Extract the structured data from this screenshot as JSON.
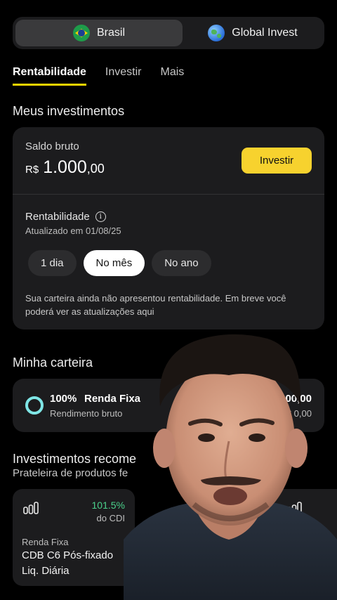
{
  "region": {
    "options": [
      {
        "label": "Brasil",
        "icon": "brazil-flag-icon",
        "active": true
      },
      {
        "label": "Global Invest",
        "icon": "globe-icon",
        "active": false
      }
    ]
  },
  "tabs": [
    "Rentabilidade",
    "Investir",
    "Mais"
  ],
  "section_investments": "Meus investimentos",
  "investments": {
    "saldo_label": "Saldo bruto",
    "currency": "R$",
    "value_int": "1.000",
    "value_dec": ",00",
    "invest_button": "Investir",
    "rent_title": "Rentabilidade",
    "updated": "Atualizado em 01/08/25",
    "periods": [
      "1 dia",
      "No mês",
      "No ano"
    ],
    "selected_period": "No mês",
    "note": "Sua carteira ainda não apresentou rentabilidade. Em breve você poderá ver as atualizações aqui"
  },
  "wallet": {
    "title": "Minha carteira",
    "pct": "100%",
    "name": "Renda Fixa",
    "sub": "Rendimento bruto",
    "value": "000,00",
    "value2": "R$ 0,00",
    "ring_color": "#7fe6e6"
  },
  "recommended": {
    "title": "Investimentos recome",
    "subtitle": "Prateleira de produtos fe",
    "products": [
      {
        "rate": "101.5%",
        "ref": "do CDI",
        "category": "Renda Fixa",
        "name": "CDB C6 Pós-fixado",
        "liquidity": "Liq. Diária"
      }
    ]
  },
  "colors": {
    "accent": "#f7d22e",
    "positive": "#4ad08a",
    "card": "#1c1c1e"
  }
}
